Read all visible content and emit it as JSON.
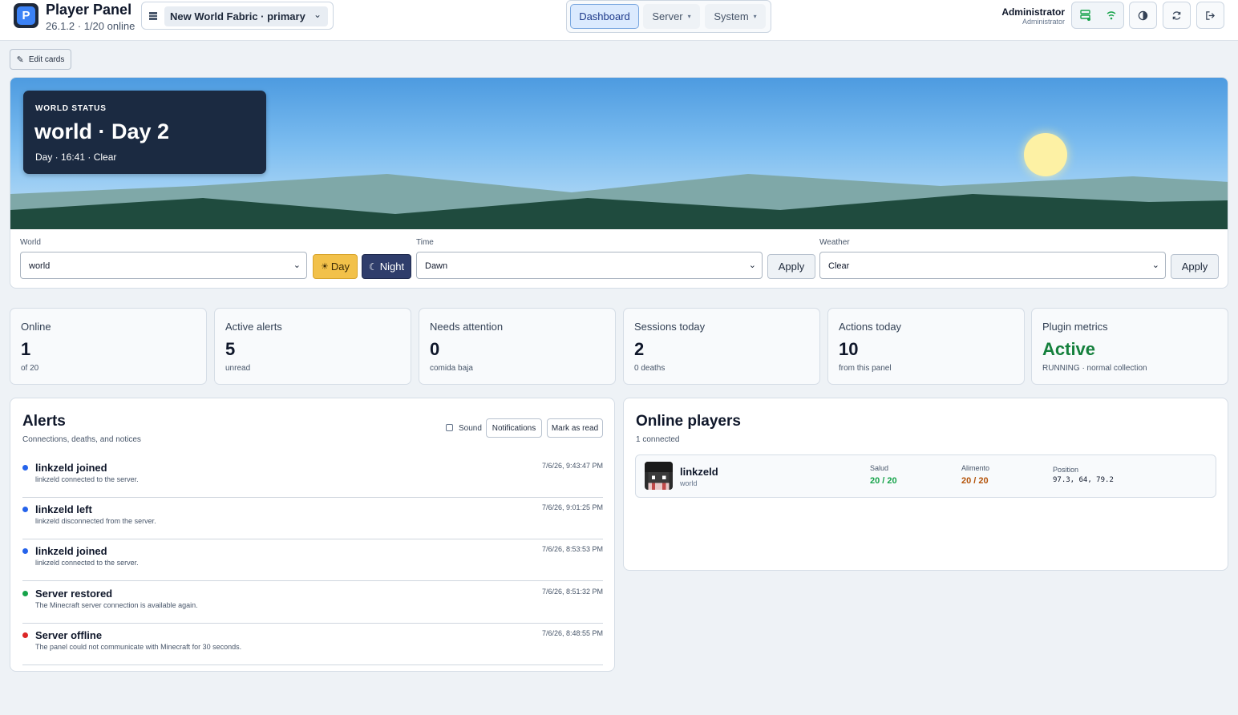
{
  "header": {
    "app_title": "Player Panel",
    "app_subtitle": "26.1.2 · 1/20 online",
    "logo_letter": "P",
    "server_select": "New World Fabric · primary",
    "nav": {
      "dashboard": "Dashboard",
      "server": "Server",
      "system": "System"
    },
    "user_name": "Administrator",
    "user_role": "Administrator"
  },
  "edit_cards_label": "Edit cards",
  "world_status": {
    "tag": "World status",
    "title": "world · Day 2",
    "subtitle": "Day · 16:41 · Clear",
    "world_label": "World",
    "world_value": "world",
    "day_button": "Day",
    "night_button": "Night",
    "time_label": "Time",
    "time_value": "Dawn",
    "time_apply": "Apply",
    "weather_label": "Weather",
    "weather_value": "Clear",
    "weather_apply": "Apply"
  },
  "stats": [
    {
      "label": "Online",
      "value": "1",
      "sub": "of 20"
    },
    {
      "label": "Active alerts",
      "value": "5",
      "sub": "unread"
    },
    {
      "label": "Needs attention",
      "value": "0",
      "sub": "comida baja"
    },
    {
      "label": "Sessions today",
      "value": "2",
      "sub": "0 deaths"
    },
    {
      "label": "Actions today",
      "value": "10",
      "sub": "from this panel"
    },
    {
      "label": "Plugin metrics",
      "value": "Active",
      "sub": "RUNNING · normal collection"
    }
  ],
  "alerts": {
    "title": "Alerts",
    "subtitle": "Connections, deaths, and notices",
    "sound_label": "Sound",
    "notifications_button": "Notifications",
    "mark_read_button": "Mark as read",
    "items": [
      {
        "title": "linkzeld joined",
        "message": "linkzeld connected to the server.",
        "time": "7/6/26, 9:43:47 PM",
        "color": "#2563eb"
      },
      {
        "title": "linkzeld left",
        "message": "linkzeld disconnected from the server.",
        "time": "7/6/26, 9:01:25 PM",
        "color": "#2563eb"
      },
      {
        "title": "linkzeld joined",
        "message": "linkzeld connected to the server.",
        "time": "7/6/26, 8:53:53 PM",
        "color": "#2563eb"
      },
      {
        "title": "Server restored",
        "message": "The Minecraft server connection is available again.",
        "time": "7/6/26, 8:51:32 PM",
        "color": "#16a34a"
      },
      {
        "title": "Server offline",
        "message": "The panel could not communicate with Minecraft for 30 seconds.",
        "time": "7/6/26, 8:48:55 PM",
        "color": "#dc2626"
      }
    ]
  },
  "players": {
    "title": "Online players",
    "subtitle": "1 connected",
    "list": [
      {
        "name": "linkzeld",
        "world": "world",
        "health_label": "Salud",
        "health_value": "20 / 20",
        "food_label": "Alimento",
        "food_value": "20 / 20",
        "position_label": "Position",
        "position_value": "97.3, 64, 79.2"
      }
    ]
  },
  "colors": {
    "accent": "#2563eb",
    "health": "#16a34a",
    "food": "#b45309",
    "active": "#15803d",
    "day_button": "#f2c14a",
    "night_button": "#2f3d6b"
  }
}
